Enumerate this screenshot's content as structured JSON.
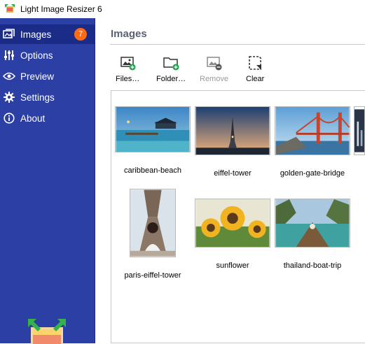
{
  "window": {
    "title": "Light Image Resizer 6"
  },
  "sidebar": {
    "items": [
      {
        "label": "Images",
        "badge": "7",
        "icon": "images-icon"
      },
      {
        "label": "Options",
        "icon": "sliders-icon"
      },
      {
        "label": "Preview",
        "icon": "eye-icon"
      },
      {
        "label": "Settings",
        "icon": "gear-icon"
      },
      {
        "label": "About",
        "icon": "info-icon"
      }
    ]
  },
  "main": {
    "title": "Images",
    "toolbar": {
      "files": "Files…",
      "folder": "Folder…",
      "remove": "Remove",
      "clear": "Clear"
    },
    "images": [
      {
        "name": "caribbean-beach"
      },
      {
        "name": "eiffel-tower"
      },
      {
        "name": "golden-gate-bridge"
      },
      {
        "name": "paris-eiffel-tower"
      },
      {
        "name": "sunflower"
      },
      {
        "name": "thailand-boat-trip"
      }
    ]
  },
  "colors": {
    "sidebar": "#2b3fa5",
    "active_item": "#1b2c88",
    "badge": "#ff6a13",
    "add_green": "#1aa34a"
  }
}
